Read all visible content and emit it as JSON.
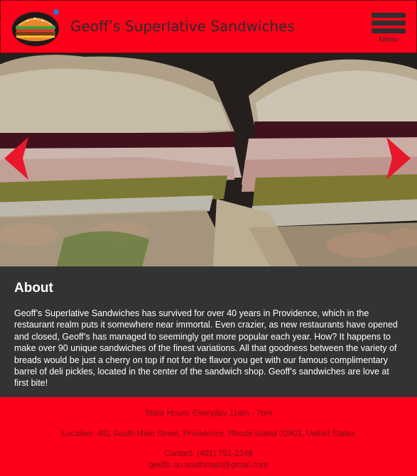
{
  "header": {
    "brand": "Geoff’s Superlative Sandwiches",
    "menu_label": "Menu"
  },
  "icons": {
    "logo": "burger-logo-icon",
    "menu": "hamburger-menu-icon",
    "prev": "chevron-left-icon",
    "next": "chevron-right-icon"
  },
  "colors": {
    "brand_red": "#fe0019",
    "dark": "#333333",
    "footer_text": "#7a1016"
  },
  "about": {
    "heading": "About",
    "body": "Geoff’s Superlative Sandwiches has survived for over 40 years in Providence, which in the restaurant realm puts it somewhere near immortal. Even crazier, as new restaurants have opened and closed, Geoff’s has managed to seemingly get more popular each year. How? It happens to make over 90 unique sandwiches of the finest variations.  All that goodness between the variety of breads would be just a cherry on top if not for the flavor you get with our famous complimentary barrel of deli pickles, located in the center of the sandwich shop. Geoff’s sandwiches are love at first bite!"
  },
  "footer": {
    "hours": "Store Hours: Everyday 11am - 7pm",
    "location": "Location: 401 South Main Street, Providence, Rhode Island 02903, United States",
    "contact": "Contact: (401) 751-2248",
    "email": "geoffs.on.southmain@gmail.com"
  }
}
